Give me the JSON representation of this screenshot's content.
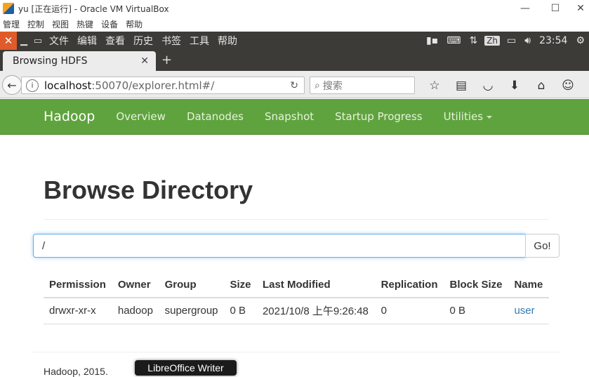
{
  "vbox": {
    "window_title": "yu [正在运行] - Oracle VM VirtualBox",
    "menu": [
      "管理",
      "控制",
      "视图",
      "热键",
      "设备",
      "帮助"
    ],
    "minimize_glyph": "—",
    "maximize_glyph": "☐",
    "close_glyph": "✕"
  },
  "ubuntu_panel": {
    "menus": [
      "文件",
      "编辑",
      "查看",
      "历史",
      "书签",
      "工具",
      "帮助"
    ],
    "input_method": "Zh",
    "clock": "23:54"
  },
  "browser": {
    "tab_title": "Browsing HDFS",
    "url_host": "localhost",
    "url_rest": ":50070/explorer.html#/",
    "search_placeholder": "搜索"
  },
  "hadoop_nav": {
    "brand": "Hadoop",
    "items": [
      "Overview",
      "Datanodes",
      "Snapshot",
      "Startup Progress",
      "Utilities"
    ]
  },
  "page": {
    "title": "Browse Directory",
    "path_value": "/",
    "go_label": "Go!",
    "columns": [
      "Permission",
      "Owner",
      "Group",
      "Size",
      "Last Modified",
      "Replication",
      "Block Size",
      "Name"
    ],
    "rows": [
      {
        "permission": "drwxr-xr-x",
        "owner": "hadoop",
        "group": "supergroup",
        "size": "0 B",
        "last_modified": "2021/10/8 上午9:26:48",
        "replication": "0",
        "block_size": "0 B",
        "name": "user"
      }
    ],
    "footer_text": "Hadoop, 2015."
  },
  "tooltip": "LibreOffice Writer",
  "colors": {
    "hadoop_green": "#5fa33e",
    "link_blue": "#337ab7",
    "panel_dark": "#3c3b37"
  }
}
